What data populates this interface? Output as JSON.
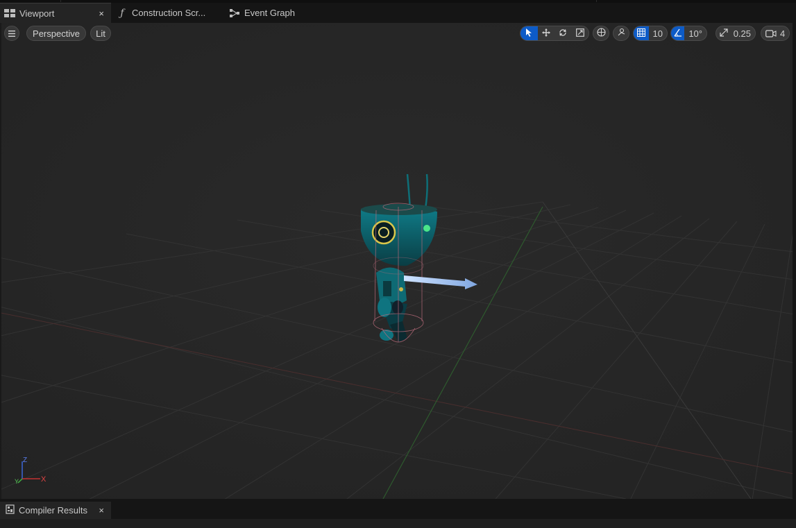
{
  "tabs": [
    {
      "label": "Viewport",
      "icon": "viewport-icon",
      "active": true,
      "close": "×"
    },
    {
      "label": "Construction Scr...",
      "icon": "function-icon",
      "active": false
    },
    {
      "label": "Event Graph",
      "icon": "graph-icon",
      "active": false
    }
  ],
  "viewport": {
    "view_mode": "Perspective",
    "lighting": "Lit",
    "grid_snap": "10",
    "rotation_snap": "10°",
    "scale_snap": "0.25",
    "camera_speed": "4",
    "axis_x": "X",
    "axis_y": "Y",
    "axis_z": "Z"
  },
  "bottom": {
    "tab_label": "Compiler Results",
    "close": "×"
  },
  "colors": {
    "selected": "#0d5bc7",
    "viewport_bg": "#262626",
    "grid_line": "#333333"
  }
}
